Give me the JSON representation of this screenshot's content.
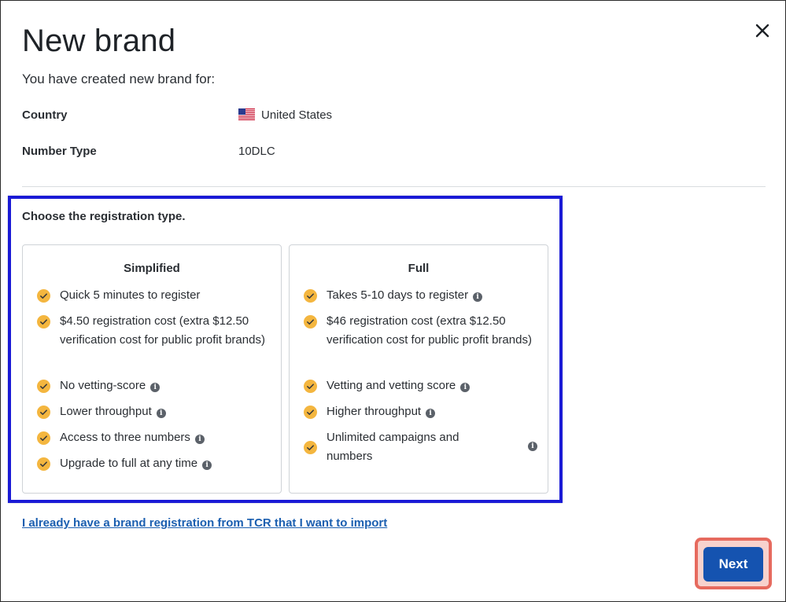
{
  "dialog": {
    "title": "New brand",
    "subtitle": "You have created new brand for:",
    "close_icon": "close-icon"
  },
  "details": {
    "country_label": "Country",
    "country_value": "United States",
    "country_flag_icon": "us-flag-icon",
    "number_type_label": "Number Type",
    "number_type_value": "10DLC"
  },
  "registration": {
    "prompt": "Choose the registration type.",
    "options": [
      {
        "title": "Simplified",
        "features": [
          "Quick 5 minutes to register",
          "$4.50 registration cost (extra $12.50 verification cost for public profit brands)",
          "No vetting-score",
          "Lower throughput",
          "Access to three numbers",
          "Upgrade to full at any time"
        ]
      },
      {
        "title": "Full",
        "features": [
          "Takes 5-10 days to register",
          "$46 registration cost (extra $12.50 verification cost for public profit brands)",
          "Vetting and vetting score",
          "Higher throughput",
          "Unlimited campaigns and numbers"
        ]
      }
    ]
  },
  "import_link": "I already have a brand registration from TCR that I want to import",
  "next_button": "Next",
  "colors": {
    "primary": "#1553b0",
    "link": "#1b5fb0",
    "check": "#f4b63f",
    "highlight_blue": "#1a1ad6",
    "highlight_red": "#e66a5e"
  }
}
